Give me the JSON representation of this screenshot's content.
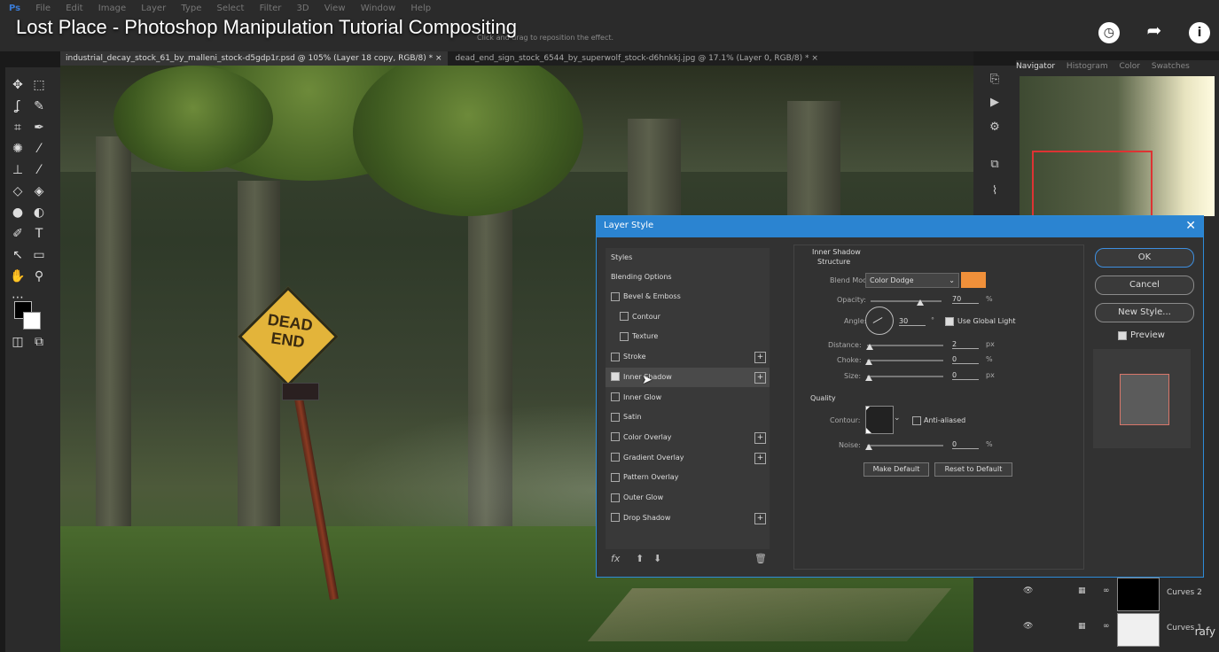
{
  "menu": [
    "File",
    "Edit",
    "Image",
    "Layer",
    "Type",
    "Select",
    "Filter",
    "3D",
    "View",
    "Window",
    "Help"
  ],
  "app_logo": "Ps",
  "video_title": "Lost Place - Photoshop Manipulation Tutorial Compositing",
  "options_hint": "Click and drag to reposition the effect.",
  "tabs": [
    {
      "label": "industrial_decay_stock_61_by_malleni_stock-d5gdp1r.psd @ 105% (Layer 18 copy, RGB/8) *  ×"
    },
    {
      "label": "dead_end_sign_stock_6544_by_superwolf_stock-d6hnkkj.jpg @ 17.1% (Layer 0, RGB/8) *  ×"
    }
  ],
  "sign": {
    "line1": "DEAD",
    "line2": "END"
  },
  "navigator_tabs": [
    "Navigator",
    "Histogram",
    "Color",
    "Swatches"
  ],
  "layers": [
    {
      "name": "Curves 2"
    },
    {
      "name": "Curves 1"
    }
  ],
  "watermark": "rafy",
  "dialog": {
    "title": "Layer Style",
    "close": "✕",
    "styles_header": "Styles",
    "blending_options": "Blending Options",
    "styles": [
      {
        "label": "Bevel & Emboss",
        "checked": false,
        "plus": false,
        "indent": false
      },
      {
        "label": "Contour",
        "checked": false,
        "plus": false,
        "indent": true
      },
      {
        "label": "Texture",
        "checked": false,
        "plus": false,
        "indent": true
      },
      {
        "label": "Stroke",
        "checked": false,
        "plus": true,
        "indent": false
      },
      {
        "label": "Inner Shadow",
        "checked": true,
        "plus": true,
        "indent": false
      },
      {
        "label": "Inner Glow",
        "checked": false,
        "plus": false,
        "indent": false
      },
      {
        "label": "Satin",
        "checked": false,
        "plus": false,
        "indent": false
      },
      {
        "label": "Color Overlay",
        "checked": false,
        "plus": true,
        "indent": false
      },
      {
        "label": "Gradient Overlay",
        "checked": false,
        "plus": true,
        "indent": false
      },
      {
        "label": "Pattern Overlay",
        "checked": false,
        "plus": false,
        "indent": false
      },
      {
        "label": "Outer Glow",
        "checked": false,
        "plus": false,
        "indent": false
      },
      {
        "label": "Drop Shadow",
        "checked": false,
        "plus": true,
        "indent": false
      }
    ],
    "footer_fx": "fx",
    "section_title": "Inner Shadow",
    "structure_title": "Structure",
    "blend_mode_label": "Blend Mode:",
    "blend_mode_value": "Color Dodge",
    "blend_color": "#f0903a",
    "opacity_label": "Opacity:",
    "opacity_value": "70",
    "opacity_fraction": 0.7,
    "pct": "%",
    "angle_label": "Angle:",
    "angle_value": "30",
    "angle_unit": "°",
    "use_global_light": "Use Global Light",
    "distance_label": "Distance:",
    "distance_value": "2",
    "choke_label": "Choke:",
    "choke_value": "0",
    "size_label": "Size:",
    "size_value": "0",
    "px": "px",
    "quality_title": "Quality",
    "contour_label": "Contour:",
    "anti_aliased": "Anti-aliased",
    "noise_label": "Noise:",
    "noise_value": "0",
    "make_default": "Make Default",
    "reset_default": "Reset to Default",
    "ok": "OK",
    "cancel": "Cancel",
    "new_style": "New Style...",
    "preview": "Preview"
  }
}
